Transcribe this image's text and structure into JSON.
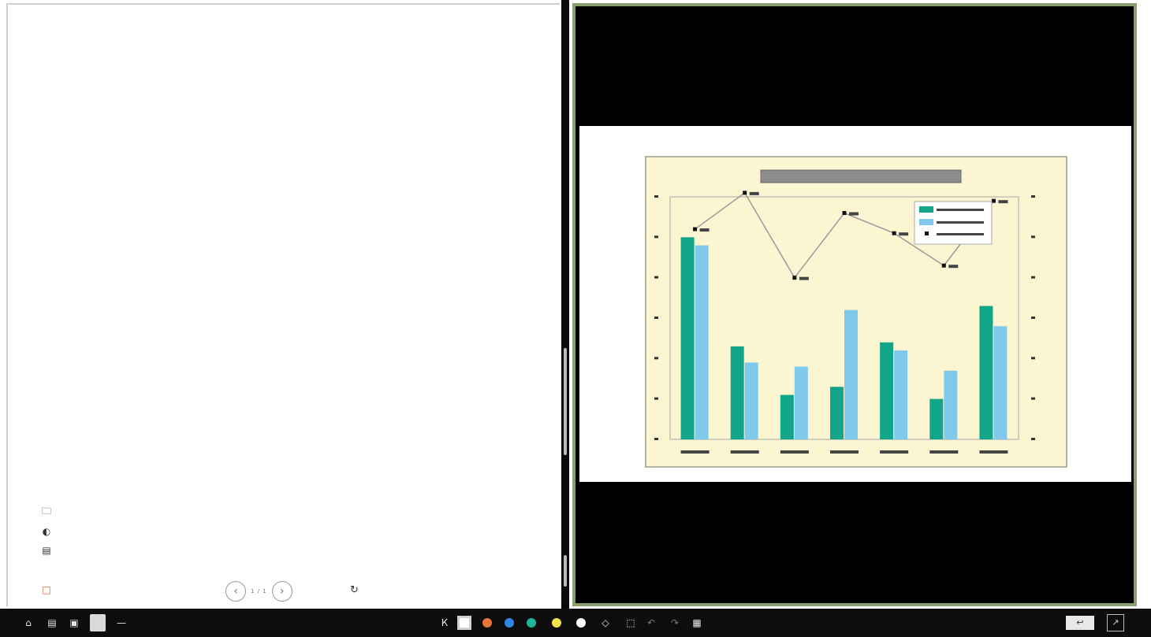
{
  "whiteboard": {
    "side_icons": [
      "folder-icon",
      "palette-icon",
      "save-icon"
    ],
    "lasso_icon": "lasso-icon"
  },
  "pager": {
    "text": "1 / 1",
    "prev_icon": "chevron-left-icon",
    "next_icon": "chevron-right-icon"
  },
  "rotate_icon": "rotate-icon",
  "viewer": {
    "border_color": "#8aa06c"
  },
  "chart_data": {
    "type": "bar",
    "categories": [
      "",
      "",
      "",
      "",
      "",
      "",
      ""
    ],
    "series": [
      {
        "values": [
          50,
          23,
          11,
          13,
          24,
          10,
          33
        ],
        "color": "#13a58a"
      },
      {
        "values": [
          48,
          19,
          18,
          32,
          22,
          17,
          28
        ],
        "color": "#7fc9ec"
      },
      {
        "type": "line",
        "values": [
          52,
          61,
          40,
          56,
          51,
          43,
          59
        ],
        "color": "#9a9a9a"
      }
    ],
    "ylim": [
      0,
      60
    ],
    "grid": false,
    "legend": "top-right"
  },
  "taskbar": {
    "left_icons": [
      "home-icon",
      "files-icon",
      "camera-icon",
      "document-icon",
      "minus-icon"
    ],
    "tools": [
      "text-cursor-icon",
      "square-icon"
    ],
    "colors": [
      "#e8763a",
      "#2f86e6",
      "#1fb59b",
      "#f2e24a",
      "#ffffff"
    ],
    "extra_icons": [
      "eraser-icon",
      "select-icon",
      "undo-icon",
      "redo-icon",
      "delete-icon"
    ],
    "right_icons": [
      "back-icon",
      "fullscreen-icon"
    ]
  }
}
